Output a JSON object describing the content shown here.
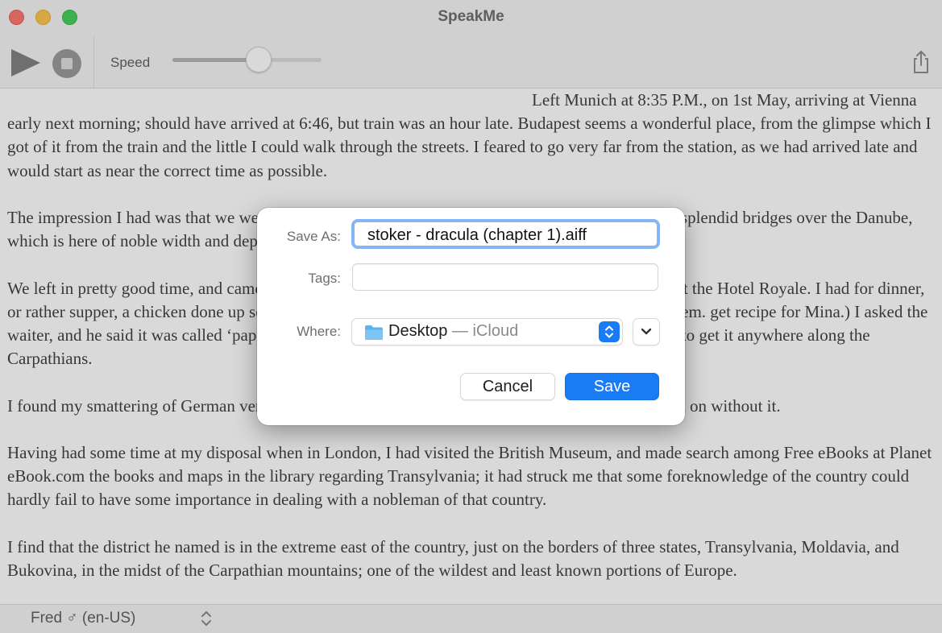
{
  "window": {
    "title": "SpeakMe"
  },
  "toolbar": {
    "speed_label": "Speed",
    "speed_value": 0.58
  },
  "document": {
    "paragraphs": [
      "Left Munich at 8:35 P.M., on 1st May, arriving at Vienna early next morning; should have arrived at 6:46, but train was an hour late. Budapest seems a wonderful place, from the glimpse which I got of it from the train and the little I could walk through the streets. I feared to go very far from the station, as we had arrived late and would start as near the correct time as possible.",
      "The impression I had was that we were leaving the West and entering the East; the most western of splendid bridges over the Danube, which is here of noble width and depth, took us among the traditions of Turkish rule.",
      "We left in pretty good time, and came after nightfall to Klausenburgh. Here I stopped for the night at the Hotel Royale. I had for dinner, or rather supper, a chicken done up some way with red pepper, which was very good but thirsty. (Mem. get recipe for Mina.) I asked the waiter, and he said it was called ‘paprika hendl,’ and that, as it was a national dish, I should be able to get it anywhere along the Carpathians.",
      "I found my smattering of German very useful here; indeed, I don’t know how I should be able to get on without it.",
      "Having had some time at my disposal when in London, I had visited the British Museum, and made search among Free eBooks at Planet eBook.com the books and maps in the library regarding Transylvania; it had struck me that some foreknowledge of the country could hardly fail to have some importance in dealing with a nobleman of that country.",
      "I find that the district he named is in the extreme east of the country, just on the borders of three states, Transylvania, Moldavia, and Bukovina, in the midst of the Carpathian mountains; one of the wildest and least known portions of Europe."
    ]
  },
  "statusbar": {
    "voice": "Fred ♂ (en-US)"
  },
  "save_dialog": {
    "save_as_label": "Save As:",
    "filename": "stoker - dracula (chapter 1).aiff",
    "tags_label": "Tags:",
    "tags_value": "",
    "where_label": "Where:",
    "where_folder": "Desktop",
    "where_location": " — iCloud",
    "cancel_label": "Cancel",
    "save_label": "Save"
  },
  "colors": {
    "accent": "#1a7cf5",
    "focus_ring": "#84b6f3",
    "close": "#ff5f57",
    "minimize": "#febc2e",
    "maximize": "#28c840"
  },
  "icons": [
    "play-icon",
    "stop-icon",
    "share-icon",
    "folder-icon",
    "chevron-updown-icon",
    "chevron-down-icon"
  ]
}
